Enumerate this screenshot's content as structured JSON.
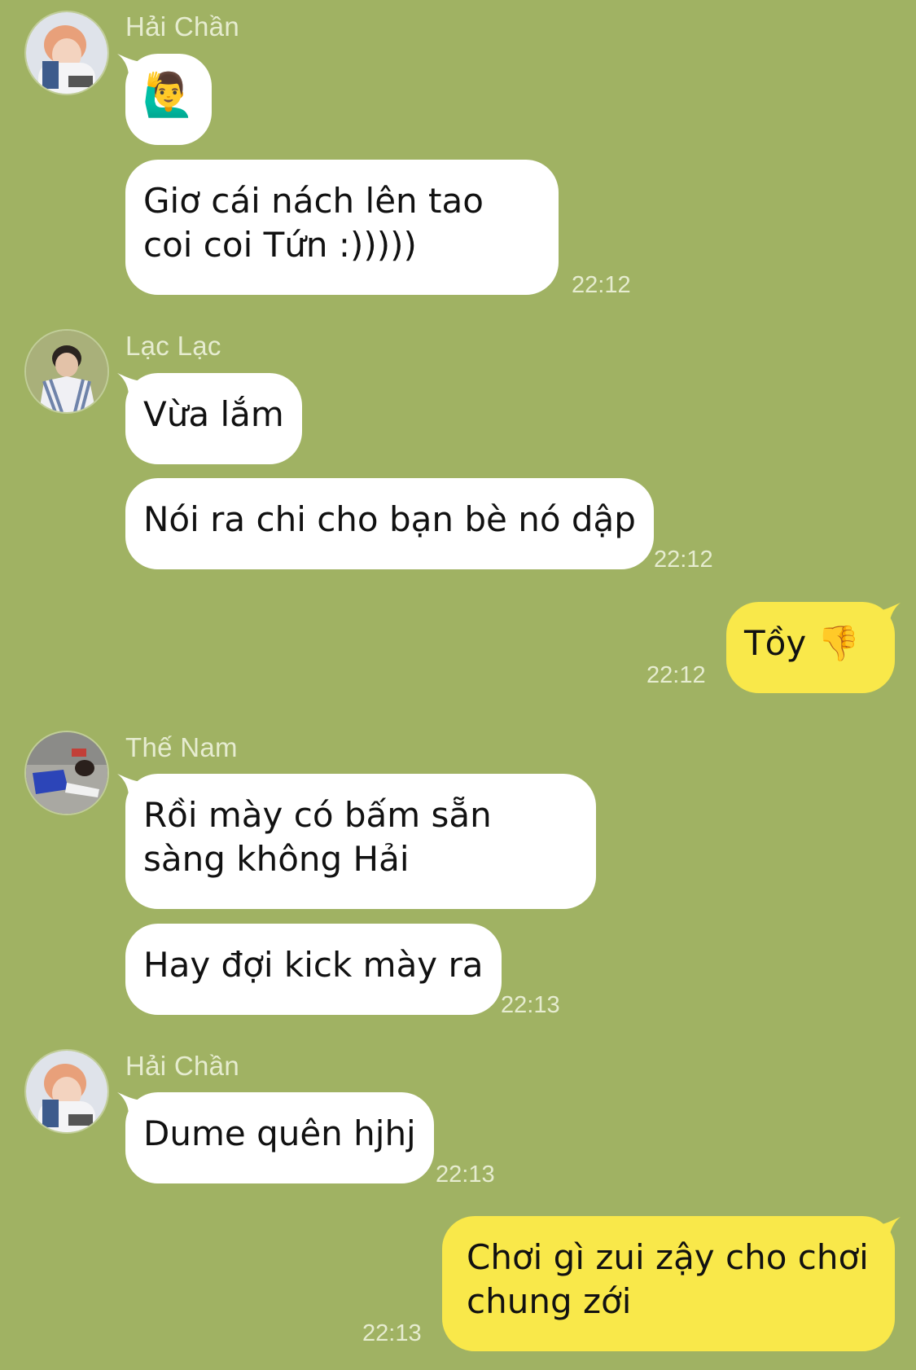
{
  "messages": [
    {
      "sender": "Hải Chần",
      "bubbles": [
        "🙋‍♂️",
        "Giơ cái nách lên tao coi coi Tứn :)))))"
      ],
      "time": "22:12"
    },
    {
      "sender": "Lạc Lạc",
      "bubbles": [
        "Vừa lắm",
        "Nói ra chi cho bạn bè nó dập"
      ],
      "time": "22:12"
    },
    {
      "self": true,
      "bubbles": [
        "Tồy 👎"
      ],
      "time": "22:12"
    },
    {
      "sender": "Thế Nam",
      "bubbles": [
        "Rồi mày có bấm sẵn sàng không Hải",
        "Hay đợi kick mày ra"
      ],
      "time": "22:13"
    },
    {
      "sender": "Hải Chần",
      "bubbles": [
        "Dume quên hjhj"
      ],
      "time": "22:13"
    },
    {
      "self": true,
      "bubbles": [
        "Chơi gì zui zậy cho chơi chung zới"
      ],
      "time": "22:13"
    }
  ],
  "colors": {
    "background": "#a0b263",
    "incoming": "#ffffff",
    "outgoing": "#f9e84a"
  }
}
